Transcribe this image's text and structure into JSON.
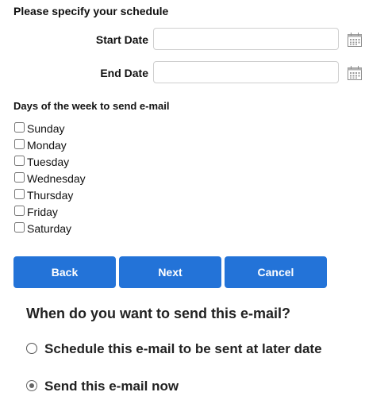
{
  "heading": "Please specify your schedule",
  "start_date": {
    "label": "Start Date",
    "value": ""
  },
  "end_date": {
    "label": "End Date",
    "value": ""
  },
  "days_title": "Days of the week to send e-mail",
  "days": [
    {
      "label": "Sunday",
      "checked": false
    },
    {
      "label": "Monday",
      "checked": false
    },
    {
      "label": "Tuesday",
      "checked": false
    },
    {
      "label": "Wednesday",
      "checked": false
    },
    {
      "label": "Thursday",
      "checked": false
    },
    {
      "label": "Friday",
      "checked": false
    },
    {
      "label": "Saturday",
      "checked": false
    }
  ],
  "buttons": {
    "back": "Back",
    "next": "Next",
    "cancel": "Cancel"
  },
  "accent_color": "#2373d8",
  "send_question": "When do you want to send this e-mail?",
  "send_options": [
    {
      "label": "Schedule this e-mail to be sent at later date",
      "selected": false
    },
    {
      "label": "Send this e-mail now",
      "selected": true
    }
  ],
  "icons": {
    "calendar": "calendar-icon"
  }
}
